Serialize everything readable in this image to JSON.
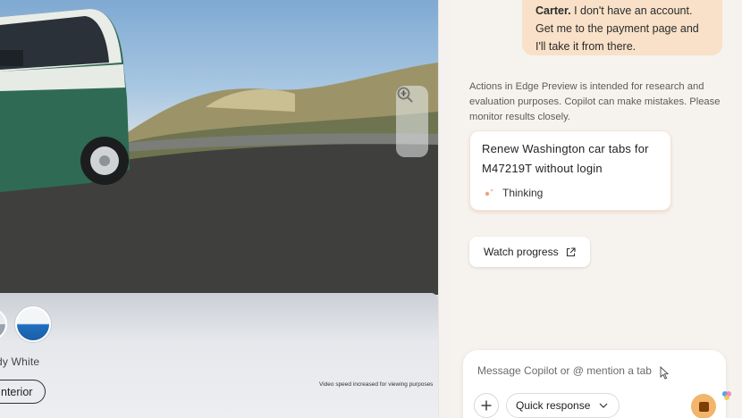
{
  "webpage": {
    "selected_color": "dy White",
    "interior_button": "nterior",
    "speed_note": "Video speed increased for viewing purposes",
    "icons": {
      "zoom_in": "zoom-in-icon",
      "zoom_out": "zoom-out-icon"
    }
  },
  "copilot": {
    "user_message": {
      "bold_part": "Carter.",
      "rest": " I don't have an account. Get me to the payment page and I'll take it from there."
    },
    "disclaimer": "Actions in Edge Preview is intended for research and evaluation purposes. Copilot can make mistakes. Please monitor results closely.",
    "task": {
      "title": "Renew Washington car tabs for M47219T without login",
      "status": "Thinking"
    },
    "watch_progress_label": "Watch progress",
    "composer": {
      "placeholder": "Message Copilot or @ mention a tab",
      "mode": "Quick response"
    },
    "colors": {
      "accent": "#f2b56b",
      "bubble": "#f8e1c8",
      "stop": "#7a3e06"
    }
  }
}
